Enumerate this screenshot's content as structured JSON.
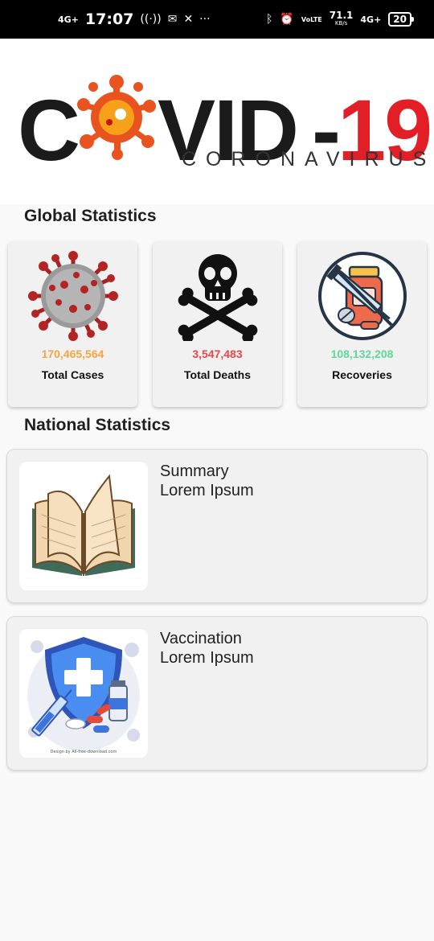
{
  "status_bar": {
    "network_left": "4G+",
    "time": "17:07",
    "speed_value": "71.1",
    "speed_unit": "KB/s",
    "volte": "VoLTE",
    "network_right": "4G+",
    "battery": "20"
  },
  "logo": {
    "c": "C",
    "vid": "VID",
    "dash": "-",
    "num": "19",
    "subtitle": "CORONAVIRUS"
  },
  "global": {
    "title": "Global Statistics",
    "cards": [
      {
        "value": "170,465,564",
        "label": "Total Cases",
        "color": "#f4a640",
        "icon": "virus-icon"
      },
      {
        "value": "3,547,483",
        "label": "Total Deaths",
        "color": "#e8474c",
        "icon": "skull-crossbones-icon"
      },
      {
        "value": "108,132,208",
        "label": "Recoveries",
        "color": "#5fd89a",
        "icon": "no-syringe-icon"
      }
    ]
  },
  "national": {
    "title": "National Statistics",
    "items": [
      {
        "title": "Summary",
        "subtitle": "Lorem Ipsum",
        "icon": "open-book-icon"
      },
      {
        "title": "Vaccination",
        "subtitle": "Lorem Ipsum",
        "icon": "vaccine-shield-icon",
        "credit": "Design by All-free-download.com"
      }
    ]
  },
  "colors": {
    "logo_red": "#e21f26",
    "logo_dark": "#1b1b1b"
  }
}
